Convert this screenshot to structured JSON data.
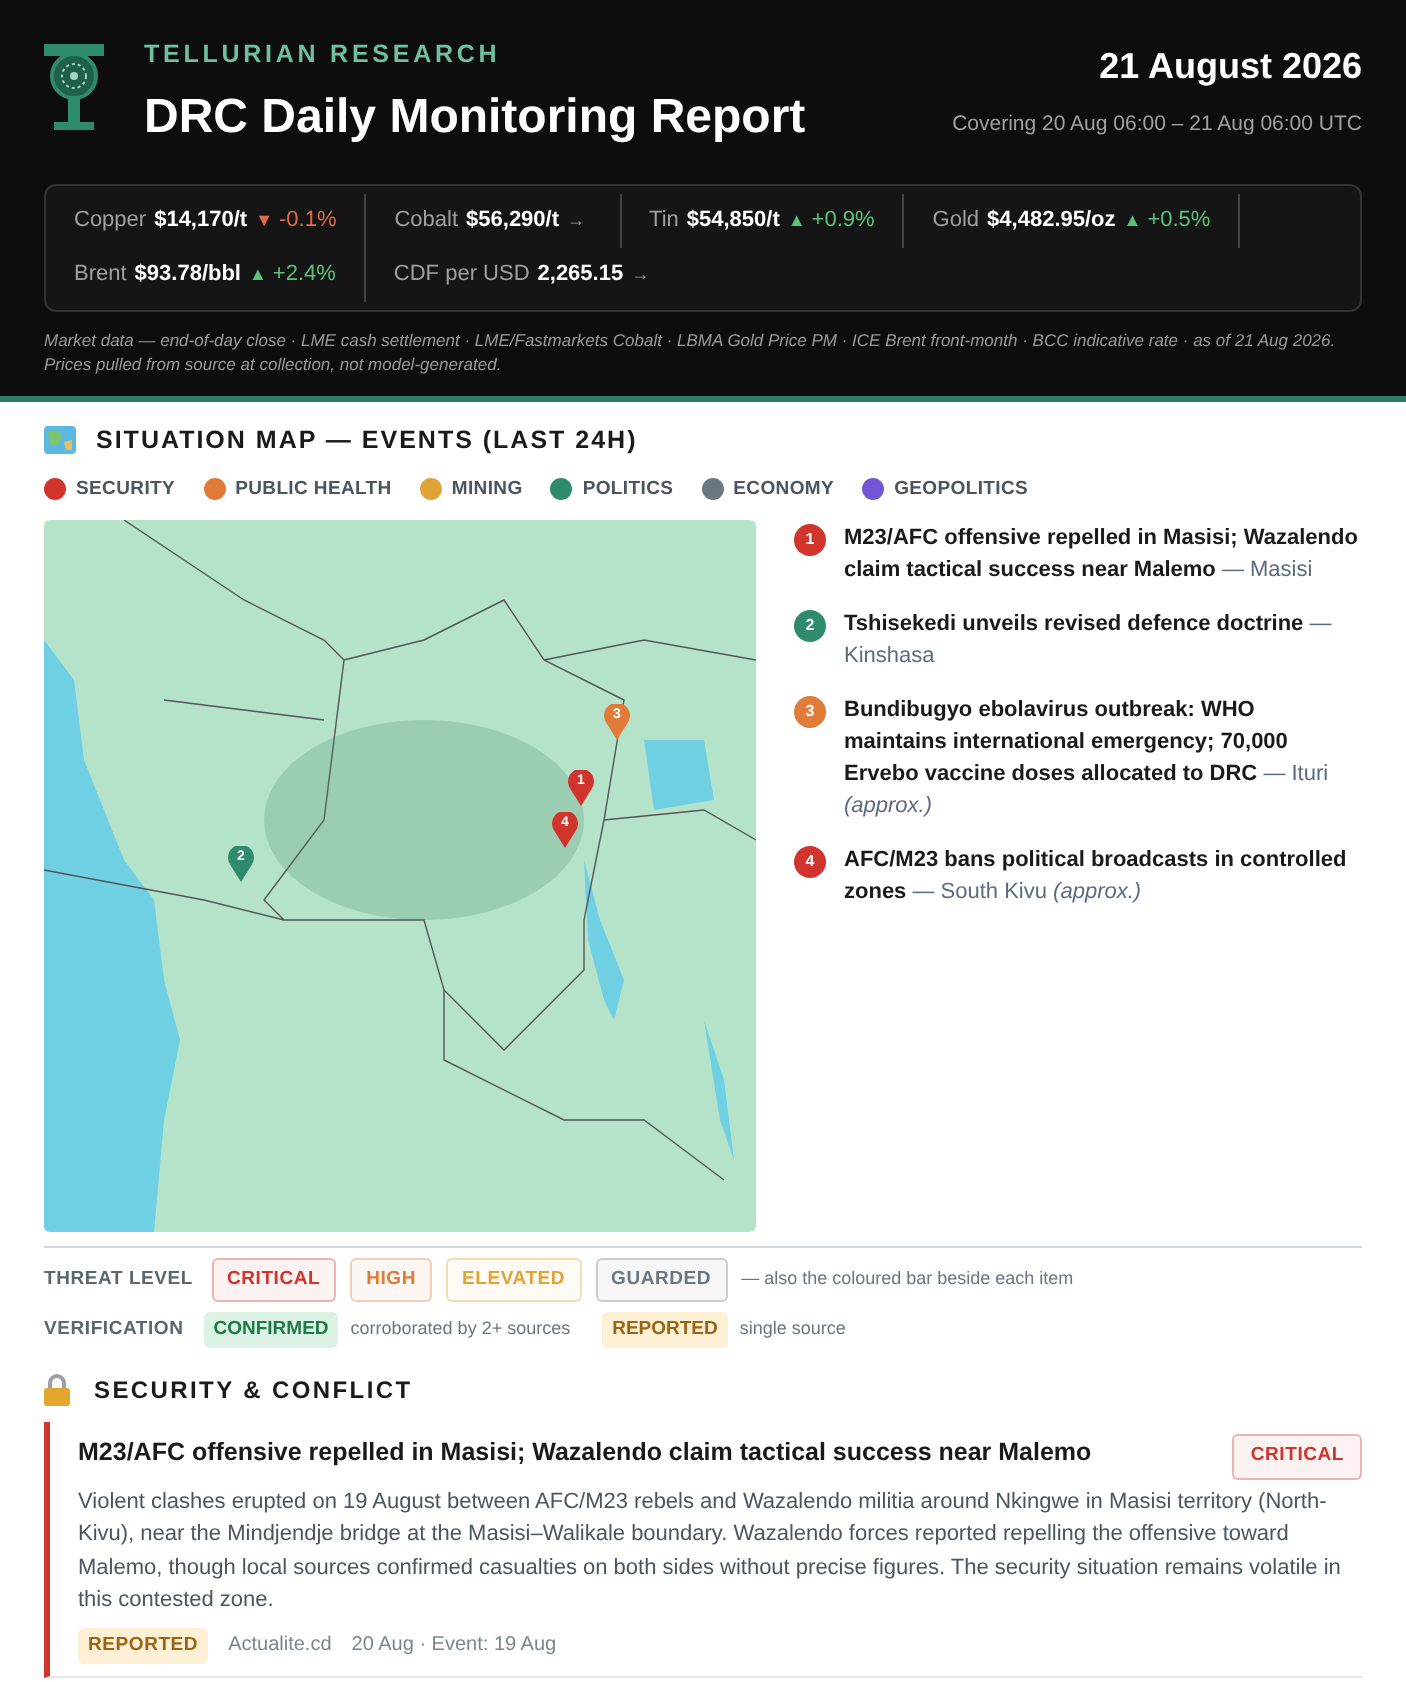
{
  "header": {
    "brand": "TELLURIAN RESEARCH",
    "title": "DRC Daily Monitoring Report",
    "date": "21 August 2026",
    "coverage": "Covering 20 Aug 06:00 – 21 Aug 06:00 UTC"
  },
  "market": {
    "items": [
      {
        "name": "Copper",
        "value": "$14,170/t",
        "kind": "down",
        "arrow": "▼",
        "change": "-0.1%"
      },
      {
        "name": "Cobalt",
        "value": "$56,290/t",
        "kind": "flat",
        "arrow": "→"
      },
      {
        "name": "Tin",
        "value": "$54,850/t",
        "kind": "up",
        "arrow": "▲",
        "change": "+0.9%"
      },
      {
        "name": "Gold",
        "value": "$4,482.95/oz",
        "kind": "up",
        "arrow": "▲",
        "change": "+0.5%"
      },
      {
        "name": "Brent",
        "value": "$93.78/bbl",
        "kind": "up",
        "arrow": "▲",
        "change": "+2.4%"
      },
      {
        "name": "CDF per USD",
        "value": "2,265.15",
        "kind": "flat",
        "arrow": "→"
      }
    ],
    "note": "Market data — end-of-day close · LME cash settlement · LME/Fastmarkets Cobalt · LBMA Gold Price PM · ICE Brent front-month · BCC indicative rate · as of 21 Aug 2026. Prices pulled from source at collection, not model-generated."
  },
  "map_section": {
    "title": "SITUATION MAP — EVENTS (LAST 24H)",
    "legend": [
      {
        "label": "SECURITY",
        "color": "#d0342c"
      },
      {
        "label": "PUBLIC HEALTH",
        "color": "#e07b39"
      },
      {
        "label": "MINING",
        "color": "#e0a33a"
      },
      {
        "label": "POLITICS",
        "color": "#2e8b6e"
      },
      {
        "label": "ECONOMY",
        "color": "#6b7780"
      },
      {
        "label": "GEOPOLITICS",
        "color": "#7356d6"
      }
    ],
    "pins": [
      {
        "label": "1",
        "color": "#d0342c"
      },
      {
        "label": "2",
        "color": "#2e8b6e"
      },
      {
        "label": "3",
        "color": "#e07b39"
      },
      {
        "label": "4",
        "color": "#d0342c"
      }
    ],
    "events": [
      {
        "number": "1",
        "color": "#d0342c",
        "title": "M23/AFC offensive repelled in Masisi; Wazalendo claim tactical success near Malemo",
        "place": "— Masisi"
      },
      {
        "number": "2",
        "color": "#2e8b6e",
        "title": "Tshisekedi unveils revised defence doctrine",
        "place": "— Kinshasa"
      },
      {
        "number": "3",
        "color": "#e07b39",
        "title": "Bundibugyo ebolavirus outbreak: WHO maintains international emergency; 70,000 Ervebo vaccine doses allocated to DRC",
        "place": "— Ituri",
        "approx": "(approx.)"
      },
      {
        "number": "4",
        "color": "#d0342c",
        "title": "AFC/M23 bans political broadcasts in controlled zones",
        "place": "— South Kivu",
        "approx": "(approx.)"
      }
    ]
  },
  "key": {
    "threat_label": "THREAT LEVEL",
    "threat_levels": [
      {
        "label": "CRITICAL",
        "color": "#d0342c"
      },
      {
        "label": "HIGH",
        "color": "#e07b39"
      },
      {
        "label": "ELEVATED",
        "color": "#e0a33a"
      },
      {
        "label": "GUARDED",
        "color": "#6b7780"
      }
    ],
    "threat_note": "— also the coloured bar beside each item",
    "verification_label": "VERIFICATION",
    "verification": [
      {
        "label": "CONFIRMED",
        "kind": "confirmed",
        "note": "corroborated by 2+ sources"
      },
      {
        "label": "REPORTED",
        "kind": "reported",
        "note": "single source"
      }
    ]
  },
  "security": {
    "title": "SECURITY & CONFLICT",
    "items": [
      {
        "title": "M23/AFC offensive repelled in Masisi; Wazalendo claim tactical success near Malemo",
        "level": "CRITICAL",
        "color": "#d0342c",
        "body": "Violent clashes erupted on 19 August between AFC/M23 rebels and Wazalendo militia around Nkingwe in Masisi territory (North-Kivu), near the Mindjendje bridge at the Masisi–Walikale boundary. Wazalendo forces reported repelling the offensive toward Malemo, though local sources confirmed casualties on both sides without precise figures. The security situation remains volatile in this contested zone.",
        "verification": {
          "label": "REPORTED",
          "kind": "reported"
        },
        "source": "Actualite.cd",
        "dates": "20 Aug · Event: 19 Aug"
      }
    ]
  }
}
